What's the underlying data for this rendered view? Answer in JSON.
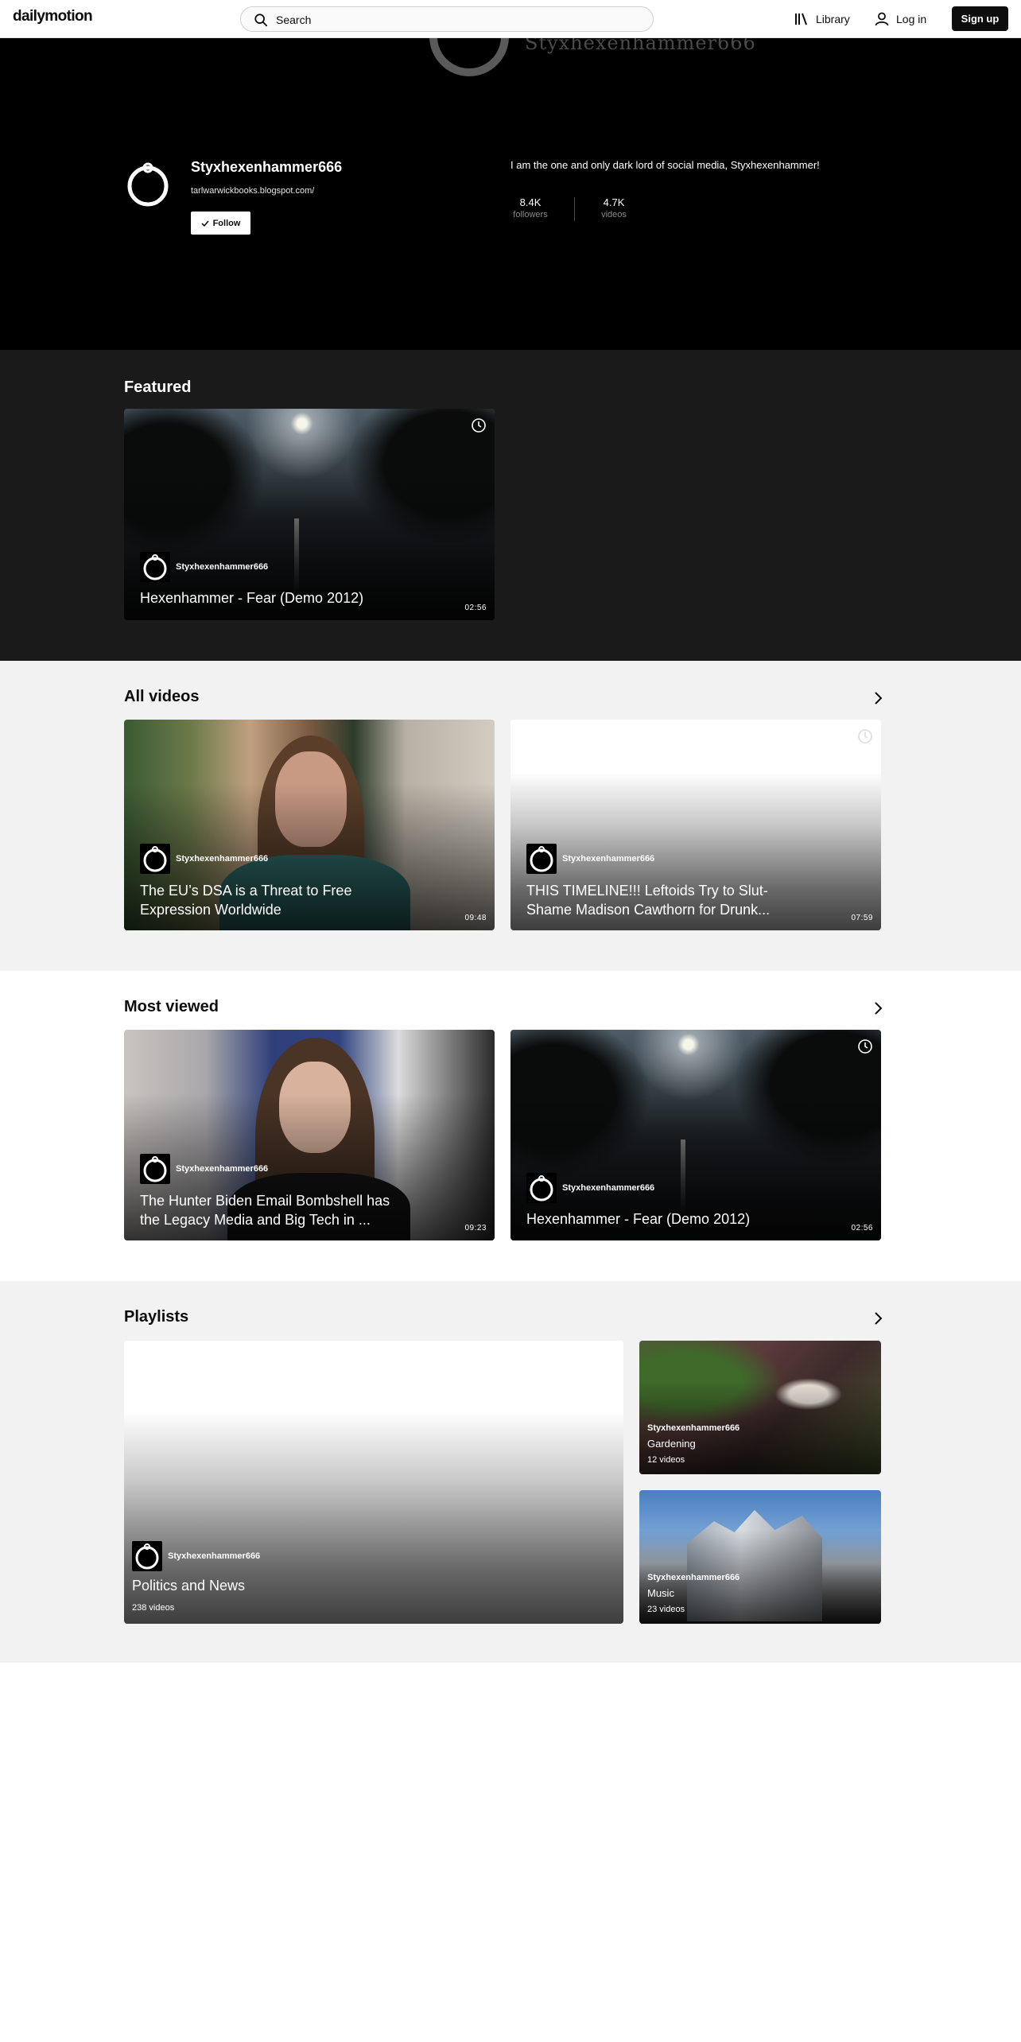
{
  "nav": {
    "logo": "dailymotion",
    "search_placeholder": "Search",
    "library_label": "Library",
    "login_label": "Log in",
    "signup_label": "Sign up"
  },
  "channel": {
    "banner_name": "Styxhexenhammer666",
    "name": "Styxhexenhammer666",
    "url": "tarlwarwickbooks.blogspot.com/",
    "follow_label": "Follow",
    "bio": "I am the one and only dark lord of social media, Styxhexenhammer!",
    "followers_count": "8.4K",
    "followers_label": "followers",
    "videos_count": "4.7K",
    "videos_label": "videos"
  },
  "featured": {
    "heading": "Featured",
    "video": {
      "channel": "Styxhexenhammer666",
      "title": "Hexenhammer - Fear (Demo 2012)",
      "duration": "02:56"
    }
  },
  "all_videos": {
    "heading": "All videos",
    "videos": [
      {
        "channel": "Styxhexenhammer666",
        "title": "The EU’s DSA is a Threat to Free Expression Worldwide",
        "duration": "09:48"
      },
      {
        "channel": "Styxhexenhammer666",
        "title": "THIS TIMELINE!!! Leftoids Try to Slut-Shame Madison Cawthorn for Drunk...",
        "duration": "07:59"
      }
    ]
  },
  "most_viewed": {
    "heading": "Most viewed",
    "videos": [
      {
        "channel": "Styxhexenhammer666",
        "title": "The Hunter Biden Email Bombshell has the Legacy Media and Big Tech in ...",
        "duration": "09:23"
      },
      {
        "channel": "Styxhexenhammer666",
        "title": "Hexenhammer - Fear (Demo 2012)",
        "duration": "02:56"
      }
    ]
  },
  "playlists": {
    "heading": "Playlists",
    "items": [
      {
        "channel": "Styxhexenhammer666",
        "title": "Politics and News",
        "count": "238 videos"
      },
      {
        "channel": "Styxhexenhammer666",
        "title": "Gardening",
        "count": "12 videos"
      },
      {
        "channel": "Styxhexenhammer666",
        "title": "Music",
        "count": "23 videos"
      }
    ]
  },
  "colors": {
    "hero_bg": "#000000",
    "featured_bg": "#1a1a1a",
    "alt_section_bg": "#f2f2f2",
    "text_dark": "#0d0d0d"
  }
}
